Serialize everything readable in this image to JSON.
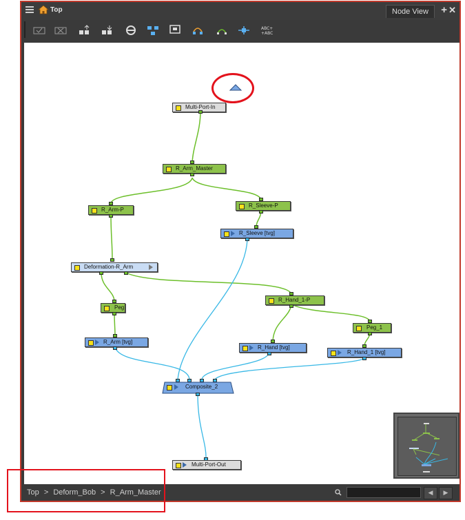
{
  "window": {
    "title": "Top",
    "tab_label": "Node View"
  },
  "nodes": {
    "multi_port_in": "Multi-Port-In",
    "r_arm_master": "R_Arm_Master",
    "r_arm_p": "R_Arm-P",
    "r_sleeve_p": "R_Sleeve-P",
    "r_sleeve_tvg": "R_Sleeve [tvg]",
    "deformation_r_arm": "Deformation-R_Arm",
    "r_hand_1_p": "R_Hand_1-P",
    "peg": "Peg",
    "peg_1": "Peg_1",
    "r_arm_tvg": "R_Arm [tvg]",
    "r_hand_tvg": "R_Hand [tvg]",
    "r_hand_1_tvg": "R_Hand_1 [tvg]",
    "composite_2": "Composite_2",
    "multi_port_out": "Multi-Port-Out"
  },
  "breadcrumb": {
    "items": [
      "Top",
      "Deform_Bob",
      "R_Arm_Master"
    ],
    "separator": ">"
  },
  "search": {
    "value": ""
  },
  "colors": {
    "highlight": "#e3121c",
    "peg_node": "#8dc24b",
    "drawing_node": "#7aa7e3",
    "deform_node": "#c9dcf4",
    "wire_green": "#6cbf2a",
    "wire_blue": "#38b8e6"
  }
}
